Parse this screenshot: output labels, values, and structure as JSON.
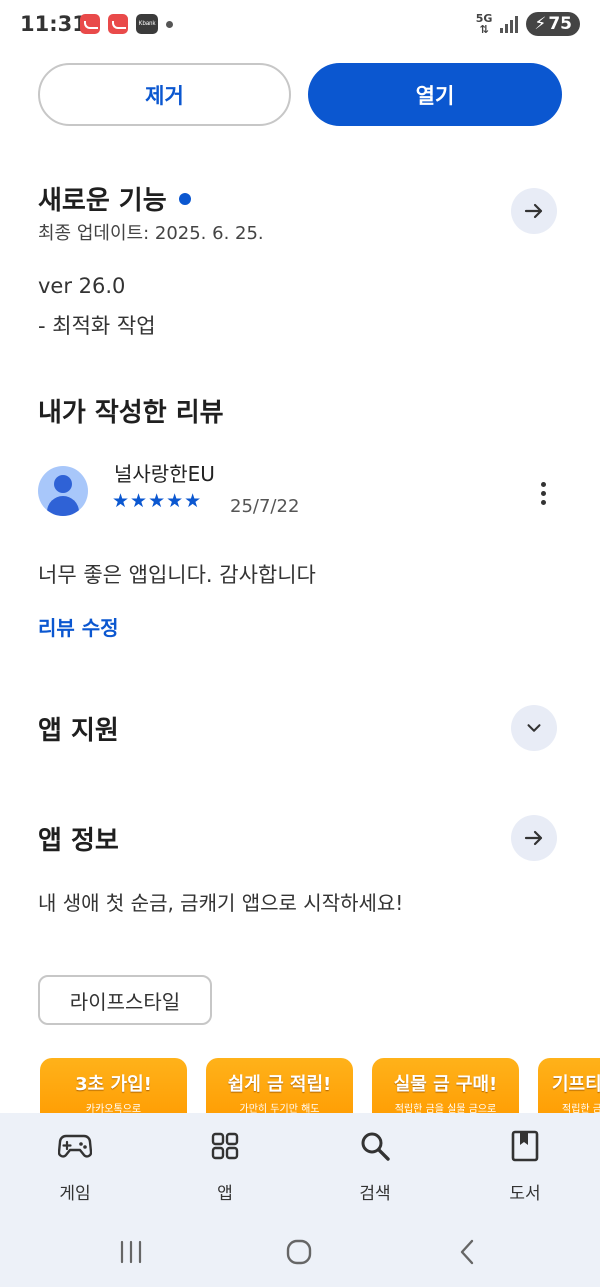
{
  "status_bar": {
    "time": "11:31",
    "notif_kbank": "Kbank",
    "network": "5G",
    "battery": "75"
  },
  "actions": {
    "remove_label": "제거",
    "open_label": "열기"
  },
  "whats_new": {
    "title": "새로운 기능",
    "last_updated": "최종 업데이트: 2025. 6. 25.",
    "version": "ver 26.0",
    "notes": "- 최적화 작업"
  },
  "my_review": {
    "title": "내가 작성한 리뷰",
    "reviewer": "널사랑한EU",
    "stars": "★★★★★",
    "rating": 5,
    "date": "25/7/22",
    "text": "너무 좋은 앱입니다. 감사합니다",
    "edit_label": "리뷰 수정"
  },
  "app_support": {
    "title": "앱 지원"
  },
  "app_info": {
    "title": "앱 정보",
    "description": "내 생애 첫 순금, 금캐기 앱으로 시작하세요!",
    "category_chip": "라이프스타일"
  },
  "screenshots": [
    {
      "title": "3초 가입!",
      "subtitle": "카카오톡으로"
    },
    {
      "title": "쉽게 금 적립!",
      "subtitle": "가만히 두기만 해도"
    },
    {
      "title": "실물 금 구매!",
      "subtitle": "적립한 금을 실물 금으로"
    },
    {
      "title": "기프티",
      "subtitle": "적립한 금"
    }
  ],
  "bottom_nav": {
    "games": "게임",
    "apps": "앱",
    "search": "검색",
    "books": "도서"
  },
  "colors": {
    "accent": "#0b57d0",
    "nav_bg": "#edf1f8",
    "card_orange": "#ffa30f"
  }
}
